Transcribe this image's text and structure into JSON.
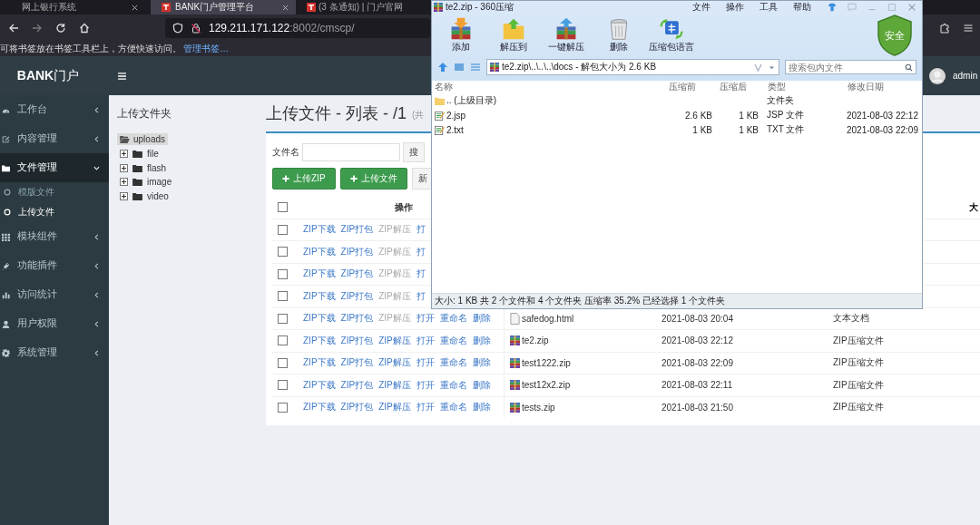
{
  "browser": {
    "tabs": [
      {
        "title": "网上银行系统",
        "selected": false,
        "closable": true
      },
      {
        "title": "BANK门户管理平台",
        "selected": true,
        "closable": true
      },
      {
        "title": "(3 条通知) | 门户官网",
        "selected": false,
        "closable": false
      }
    ],
    "address": {
      "host": "129.211.171.122",
      "path": ":8002/cmscp/"
    },
    "bookmarks_bar": {
      "message": "可将书签放在书签工具栏上，方便快速访问。",
      "link": "管理书签…"
    }
  },
  "app": {
    "logo": "**BANK**门户",
    "user": "admin"
  },
  "sidebar": [
    {
      "label": "工作台",
      "selected": false,
      "expanded": false
    },
    {
      "label": "内容管理",
      "selected": false,
      "expanded": false
    },
    {
      "label": "文件管理",
      "selected": true,
      "expanded": true,
      "children": [
        {
          "label": "模版文件",
          "selected": false
        },
        {
          "label": "上传文件",
          "selected": true
        }
      ]
    },
    {
      "label": "模块组件",
      "selected": false,
      "expanded": false
    },
    {
      "label": "功能插件",
      "selected": false,
      "expanded": false
    },
    {
      "label": "访问统计",
      "selected": false,
      "expanded": false
    },
    {
      "label": "用户权限",
      "selected": false,
      "expanded": false
    },
    {
      "label": "系统管理",
      "selected": false,
      "expanded": false
    }
  ],
  "folder_panel": {
    "title": "上传文件夹",
    "root": {
      "label": "uploads",
      "selected": true,
      "children": [
        {
          "label": "file",
          "expanded": false
        },
        {
          "label": "flash",
          "expanded": false
        },
        {
          "label": "image",
          "expanded": false
        },
        {
          "label": "video",
          "expanded": false
        }
      ]
    }
  },
  "main": {
    "title": "上传文件 - 列表 - /1",
    "count_note": "(共",
    "filter_label": "文件名",
    "search_button": "搜",
    "buttons": [
      "上传ZIP",
      "上传文件",
      "新"
    ],
    "table": {
      "header_checked": false,
      "ops_header": "操作",
      "last_header": "大",
      "rows": [
        {
          "checked": false,
          "actions": [
            {
              "label": "ZIP下载",
              "disabled": false
            },
            {
              "label": "ZIP打包",
              "disabled": false
            },
            {
              "label": "ZIP解压",
              "disabled": true
            },
            {
              "label": "打",
              "disabled": false
            }
          ]
        },
        {
          "checked": false,
          "actions": [
            {
              "label": "ZIP下载",
              "disabled": false
            },
            {
              "label": "ZIP打包",
              "disabled": false
            },
            {
              "label": "ZIP解压",
              "disabled": true
            },
            {
              "label": "打",
              "disabled": false
            }
          ]
        },
        {
          "checked": false,
          "actions": [
            {
              "label": "ZIP下载",
              "disabled": false
            },
            {
              "label": "ZIP打包",
              "disabled": false
            },
            {
              "label": "ZIP解压",
              "disabled": true
            },
            {
              "label": "打",
              "disabled": false
            }
          ]
        },
        {
          "checked": false,
          "actions": [
            {
              "label": "ZIP下载",
              "disabled": false
            },
            {
              "label": "ZIP打包",
              "disabled": false
            },
            {
              "label": "ZIP解压",
              "disabled": true
            },
            {
              "label": "打",
              "disabled": false
            }
          ]
        },
        {
          "checked": false,
          "kind": "html",
          "name": "safedog.html",
          "date": "2021-08-03 20:04",
          "type": "文本文档",
          "actions": [
            {
              "label": "ZIP下载",
              "disabled": false
            },
            {
              "label": "ZIP打包",
              "disabled": false
            },
            {
              "label": "ZIP解压",
              "disabled": true
            },
            {
              "label": "打开",
              "disabled": false
            },
            {
              "label": "重命名",
              "disabled": false
            },
            {
              "label": "删除",
              "disabled": false
            }
          ]
        },
        {
          "checked": false,
          "kind": "zip",
          "name": "te2.zip",
          "date": "2021-08-03 22:12",
          "type": "ZIP压缩文件",
          "actions": [
            {
              "label": "ZIP下载",
              "disabled": false
            },
            {
              "label": "ZIP打包",
              "disabled": false
            },
            {
              "label": "ZIP解压",
              "disabled": false
            },
            {
              "label": "打开",
              "disabled": false
            },
            {
              "label": "重命名",
              "disabled": false
            },
            {
              "label": "删除",
              "disabled": false
            }
          ]
        },
        {
          "checked": false,
          "kind": "zip",
          "name": "test1222.zip",
          "date": "2021-08-03 22:09",
          "type": "ZIP压缩文件",
          "actions": [
            {
              "label": "ZIP下载",
              "disabled": false
            },
            {
              "label": "ZIP打包",
              "disabled": false
            },
            {
              "label": "ZIP解压",
              "disabled": false
            },
            {
              "label": "打开",
              "disabled": false
            },
            {
              "label": "重命名",
              "disabled": false
            },
            {
              "label": "删除",
              "disabled": false
            }
          ]
        },
        {
          "checked": false,
          "kind": "zip",
          "name": "test12x2.zip",
          "date": "2021-08-03 22:11",
          "type": "ZIP压缩文件",
          "actions": [
            {
              "label": "ZIP下载",
              "disabled": false
            },
            {
              "label": "ZIP打包",
              "disabled": false
            },
            {
              "label": "ZIP解压",
              "disabled": false
            },
            {
              "label": "打开",
              "disabled": false
            },
            {
              "label": "重命名",
              "disabled": false
            },
            {
              "label": "删除",
              "disabled": false
            }
          ]
        },
        {
          "checked": false,
          "kind": "zip",
          "name": "tests.zip",
          "date": "2021-08-03 21:50",
          "type": "ZIP压缩文件",
          "actions": [
            {
              "label": "ZIP下载",
              "disabled": false
            },
            {
              "label": "ZIP打包",
              "disabled": false
            },
            {
              "label": "ZIP解压",
              "disabled": false
            },
            {
              "label": "打开",
              "disabled": false
            },
            {
              "label": "重命名",
              "disabled": false
            },
            {
              "label": "删除",
              "disabled": false
            }
          ]
        }
      ]
    }
  },
  "archive_window": {
    "title": "te2.zip - 360压缩",
    "menus": [
      "文件",
      "操作",
      "工具",
      "帮助"
    ],
    "tools": [
      "添加",
      "解压到",
      "一键解压",
      "删除",
      "压缩包语言"
    ],
    "badge": "安全",
    "path": "te2.zip\\..\\..\\..\\docs - 解包大小为 2.6 KB",
    "search_placeholder": "搜索包内文件",
    "columns": [
      "名称",
      "压缩前",
      "压缩后",
      "类型",
      "修改日期"
    ],
    "rows": [
      {
        "kind": "folder",
        "name": ".. (上级目录)",
        "type": "文件夹"
      },
      {
        "kind": "file",
        "name": "2.jsp",
        "size": "2.6 KB",
        "packed": "1 KB",
        "type": "JSP 文件",
        "date": "2021-08-03 22:12"
      },
      {
        "kind": "file",
        "name": "2.txt",
        "size": "1 KB",
        "packed": "1 KB",
        "type": "TXT 文件",
        "date": "2021-08-03 22:09"
      }
    ],
    "status": "大小: 1 KB 共 2 个文件和 4 个文件夹 压缩率 35.2% 已经选择 1 个文件夹"
  }
}
